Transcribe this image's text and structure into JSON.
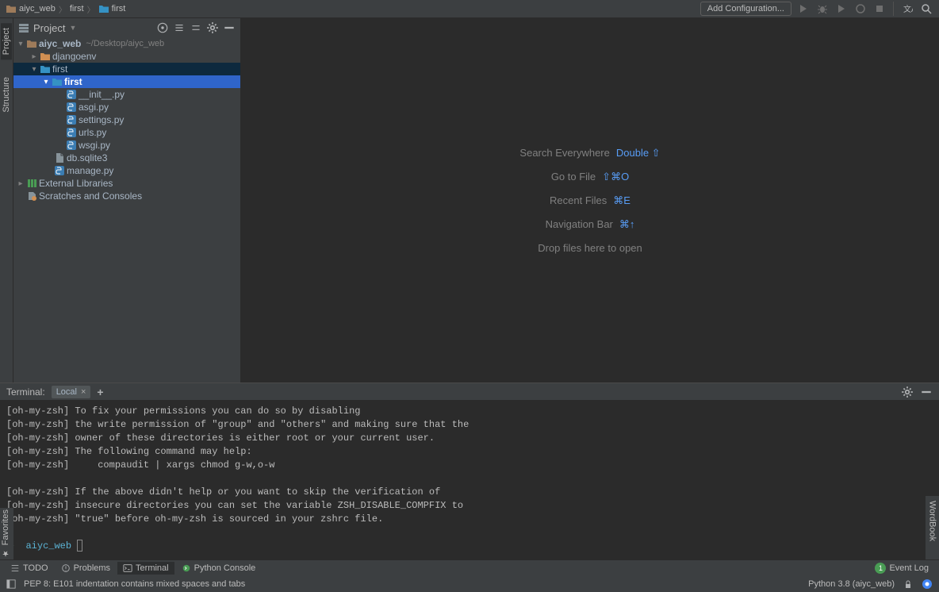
{
  "breadcrumbs": [
    "aiyc_web",
    "first",
    "first"
  ],
  "toolbar": {
    "add_config": "Add Configuration..."
  },
  "left_tabs": [
    "Project",
    "Structure"
  ],
  "project": {
    "title": "Project",
    "tree": {
      "root": {
        "name": "aiyc_web",
        "path": "~/Desktop/aiyc_web"
      },
      "djangoenv": "djangoenv",
      "first": "first",
      "first_inner": "first",
      "init": "__init__.py",
      "asgi": "asgi.py",
      "settings": "settings.py",
      "urls": "urls.py",
      "wsgi": "wsgi.py",
      "db": "db.sqlite3",
      "manage": "manage.py",
      "ext": "External Libraries",
      "scratch": "Scratches and Consoles"
    }
  },
  "hints": {
    "search": "Search Everywhere",
    "search_key": "Double ⇧",
    "goto": "Go to File",
    "goto_key": "⇧⌘O",
    "recent": "Recent Files",
    "recent_key": "⌘E",
    "nav": "Navigation Bar",
    "nav_key": "⌘↑",
    "drop": "Drop files here to open"
  },
  "terminal": {
    "title": "Terminal:",
    "tab": "Local",
    "lines": [
      "[oh-my-zsh] To fix your permissions you can do so by disabling",
      "[oh-my-zsh] the write permission of \"group\" and \"others\" and making sure that the",
      "[oh-my-zsh] owner of these directories is either root or your current user.",
      "[oh-my-zsh] The following command may help:",
      "[oh-my-zsh]     compaudit | xargs chmod g-w,o-w",
      "",
      "[oh-my-zsh] If the above didn't help or you want to skip the verification of",
      "[oh-my-zsh] insecure directories you can set the variable ZSH_DISABLE_COMPFIX to",
      "[oh-my-zsh] \"true\" before oh-my-zsh is sourced in your zshrc file."
    ],
    "prompt_dir": "aiyc_web"
  },
  "bottom": {
    "todo": "TODO",
    "problems": "Problems",
    "terminal": "Terminal",
    "pyconsole": "Python Console",
    "event_count": "1",
    "event_log": "Event Log"
  },
  "status": {
    "left": "PEP 8: E101 indentation contains mixed spaces and tabs",
    "python": "Python 3.8 (aiyc_web)"
  },
  "right_tab": "WordBook",
  "fav_tab": "Favorites"
}
